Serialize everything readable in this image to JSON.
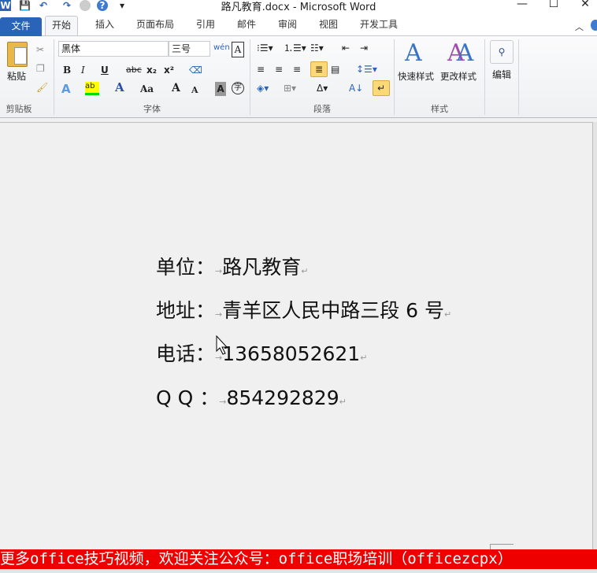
{
  "window": {
    "title": "路凡教育.docx - Microsoft Word",
    "minimize": "—",
    "maximize": "☐",
    "close": "✕"
  },
  "quick_access": {
    "word_logo": "W",
    "save": "💾",
    "undo": "↶",
    "redo": "↷",
    "help": "?",
    "customize": "▾"
  },
  "tabs": [
    {
      "label": "文件"
    },
    {
      "label": "开始"
    },
    {
      "label": "插入"
    },
    {
      "label": "页面布局"
    },
    {
      "label": "引用"
    },
    {
      "label": "邮件"
    },
    {
      "label": "审阅"
    },
    {
      "label": "视图"
    },
    {
      "label": "开发工具"
    }
  ],
  "ribbon": {
    "clipboard": {
      "label": "剪贴板",
      "paste": "粘贴"
    },
    "font": {
      "label": "字体",
      "font_name": "黑体",
      "font_size": "三号",
      "bold": "B",
      "italic": "I",
      "underline": "U",
      "strike": "abc",
      "subscript": "x₂",
      "superscript": "x²",
      "grow": "A",
      "shrink": "A",
      "case": "Aa",
      "phonetic": "wén",
      "border_char": "A",
      "shade_char": "A",
      "enclose": "字"
    },
    "paragraph": {
      "label": "段落"
    },
    "styles": {
      "label": "样式",
      "quick": "快速样式",
      "change": "更改样式"
    },
    "editing": {
      "label": "编辑"
    }
  },
  "document": {
    "lines": [
      {
        "label": "单位：",
        "value": "路凡教育"
      },
      {
        "label": "地址：",
        "value": "青羊区人民中路三段 6 号"
      },
      {
        "label": "电话：",
        "value": "13658052621"
      },
      {
        "label": "Q Q ：",
        "value": "854292829"
      }
    ],
    "tab_mark": "→",
    "para_mark": "↵"
  },
  "banner": {
    "text": "更多office技巧视频，欢迎关注公众号：office职场培训（officezcpx）"
  },
  "colors": {
    "file_tab": "#2a64b8",
    "banner": "#ee0000",
    "highlight": "#fbd977"
  }
}
